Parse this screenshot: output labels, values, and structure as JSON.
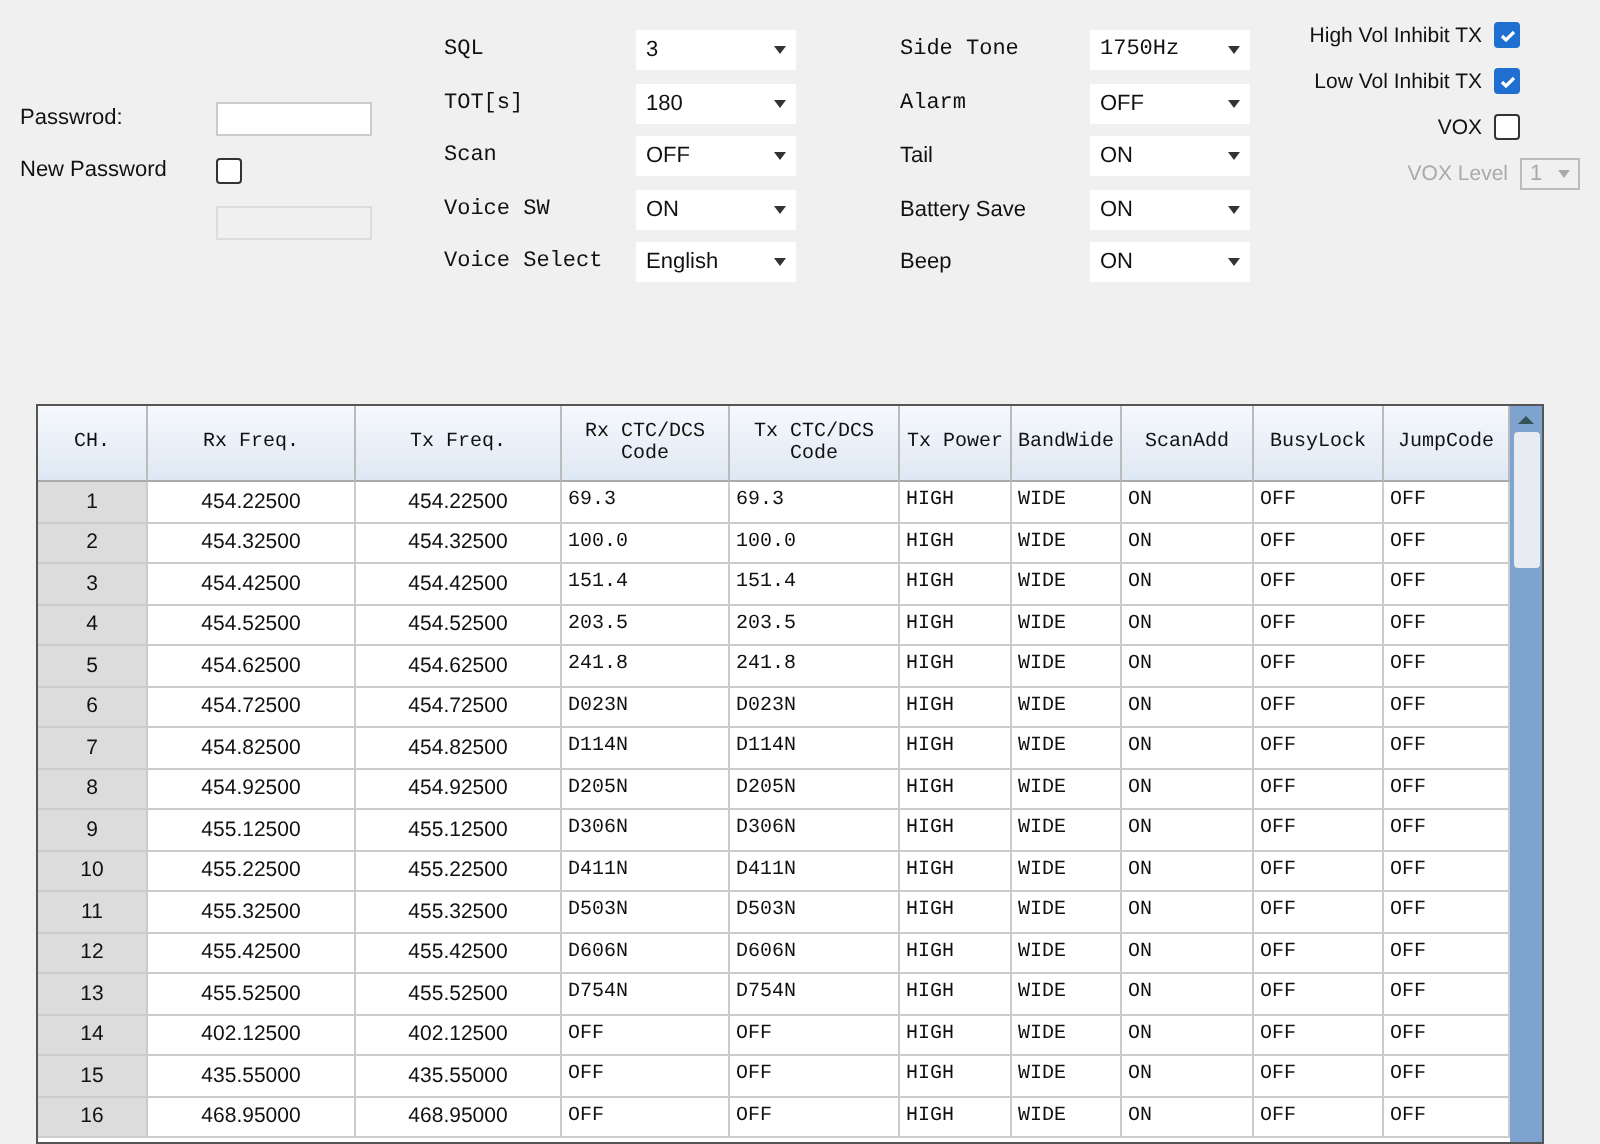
{
  "password": {
    "label": "Passwrod:",
    "new_password_label": "New Password",
    "new_password_checked": false
  },
  "settings_middle": [
    {
      "label": "SQL",
      "value": "3"
    },
    {
      "label": "TOT[s]",
      "value": "180"
    },
    {
      "label": "Scan",
      "value": "OFF"
    },
    {
      "label": "Voice SW",
      "value": "ON"
    },
    {
      "label": "Voice Select",
      "value": "English"
    }
  ],
  "settings_right": [
    {
      "label": "Side Tone",
      "value": "1750Hz"
    },
    {
      "label": "Alarm",
      "value": "OFF"
    },
    {
      "label": "Tail",
      "value": "ON"
    },
    {
      "label": "Battery Save",
      "value": "ON"
    },
    {
      "label": "Beep",
      "value": "ON"
    }
  ],
  "checkboxes": [
    {
      "label": "High Vol Inhibit TX",
      "checked": true
    },
    {
      "label": "Low Vol Inhibit TX",
      "checked": true
    },
    {
      "label": "VOX",
      "checked": false
    }
  ],
  "vox_level": {
    "label": "VOX Level",
    "value": "1",
    "disabled": true
  },
  "table": {
    "columns": [
      "CH.",
      "Rx Freq.",
      "Tx Freq.",
      "Rx CTC/DCS Code",
      "Tx CTC/DCS Code",
      "Tx Power",
      "BandWide",
      "ScanAdd",
      "BusyLock",
      "JumpCode"
    ],
    "rows": [
      [
        "1",
        "454.22500",
        "454.22500",
        "69.3",
        "69.3",
        "HIGH",
        "WIDE",
        "ON",
        "OFF",
        "OFF"
      ],
      [
        "2",
        "454.32500",
        "454.32500",
        "100.0",
        "100.0",
        "HIGH",
        "WIDE",
        "ON",
        "OFF",
        "OFF"
      ],
      [
        "3",
        "454.42500",
        "454.42500",
        "151.4",
        "151.4",
        "HIGH",
        "WIDE",
        "ON",
        "OFF",
        "OFF"
      ],
      [
        "4",
        "454.52500",
        "454.52500",
        "203.5",
        "203.5",
        "HIGH",
        "WIDE",
        "ON",
        "OFF",
        "OFF"
      ],
      [
        "5",
        "454.62500",
        "454.62500",
        "241.8",
        "241.8",
        "HIGH",
        "WIDE",
        "ON",
        "OFF",
        "OFF"
      ],
      [
        "6",
        "454.72500",
        "454.72500",
        "D023N",
        "D023N",
        "HIGH",
        "WIDE",
        "ON",
        "OFF",
        "OFF"
      ],
      [
        "7",
        "454.82500",
        "454.82500",
        "D114N",
        "D114N",
        "HIGH",
        "WIDE",
        "ON",
        "OFF",
        "OFF"
      ],
      [
        "8",
        "454.92500",
        "454.92500",
        "D205N",
        "D205N",
        "HIGH",
        "WIDE",
        "ON",
        "OFF",
        "OFF"
      ],
      [
        "9",
        "455.12500",
        "455.12500",
        "D306N",
        "D306N",
        "HIGH",
        "WIDE",
        "ON",
        "OFF",
        "OFF"
      ],
      [
        "10",
        "455.22500",
        "455.22500",
        "D411N",
        "D411N",
        "HIGH",
        "WIDE",
        "ON",
        "OFF",
        "OFF"
      ],
      [
        "11",
        "455.32500",
        "455.32500",
        "D503N",
        "D503N",
        "HIGH",
        "WIDE",
        "ON",
        "OFF",
        "OFF"
      ],
      [
        "12",
        "455.42500",
        "455.42500",
        "D606N",
        "D606N",
        "HIGH",
        "WIDE",
        "ON",
        "OFF",
        "OFF"
      ],
      [
        "13",
        "455.52500",
        "455.52500",
        "D754N",
        "D754N",
        "HIGH",
        "WIDE",
        "ON",
        "OFF",
        "OFF"
      ],
      [
        "14",
        "402.12500",
        "402.12500",
        "OFF",
        "OFF",
        "HIGH",
        "WIDE",
        "ON",
        "OFF",
        "OFF"
      ],
      [
        "15",
        "435.55000",
        "435.55000",
        "OFF",
        "OFF",
        "HIGH",
        "WIDE",
        "ON",
        "OFF",
        "OFF"
      ],
      [
        "16",
        "468.95000",
        "468.95000",
        "OFF",
        "OFF",
        "HIGH",
        "WIDE",
        "ON",
        "OFF",
        "OFF"
      ]
    ]
  }
}
